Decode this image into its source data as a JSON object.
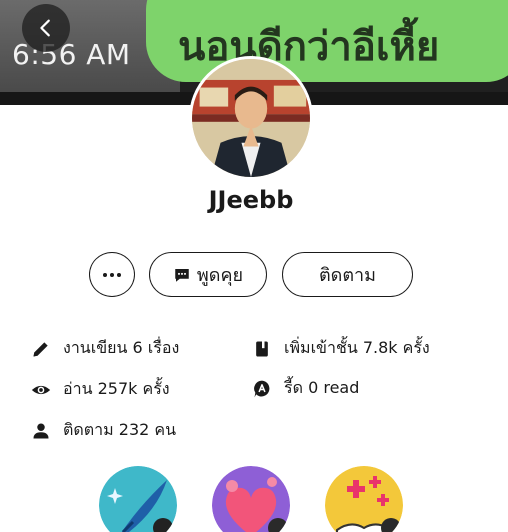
{
  "cover": {
    "time_text": "6:56 AM",
    "bubble_text": "นอนดีกว่าอีเหี้ย"
  },
  "profile": {
    "username": "JJeebb"
  },
  "actions": {
    "chat_label": "พูดคุย",
    "follow_label": "ติดตาม"
  },
  "stats": {
    "works": "งานเขียน 6 เรื่อง",
    "reads": "อ่าน 257k ครั้ง",
    "followers": "ติดตาม 232 คน",
    "library_adds": "เพิ่มเข้าชั้น 7.8k ครั้ง",
    "read_count": "รี้ด 0 read"
  },
  "icons": {
    "back": "chevron-left-icon",
    "more": "more-horizontal-icon",
    "chat": "chat-bubble-icon",
    "works": "pencil-icon",
    "reads": "eye-icon",
    "followers": "person-icon",
    "library": "book-icon",
    "read_badge": "read-a-icon"
  },
  "colors": {
    "bubble": "#7ed36b",
    "text": "#1a1a1a"
  }
}
